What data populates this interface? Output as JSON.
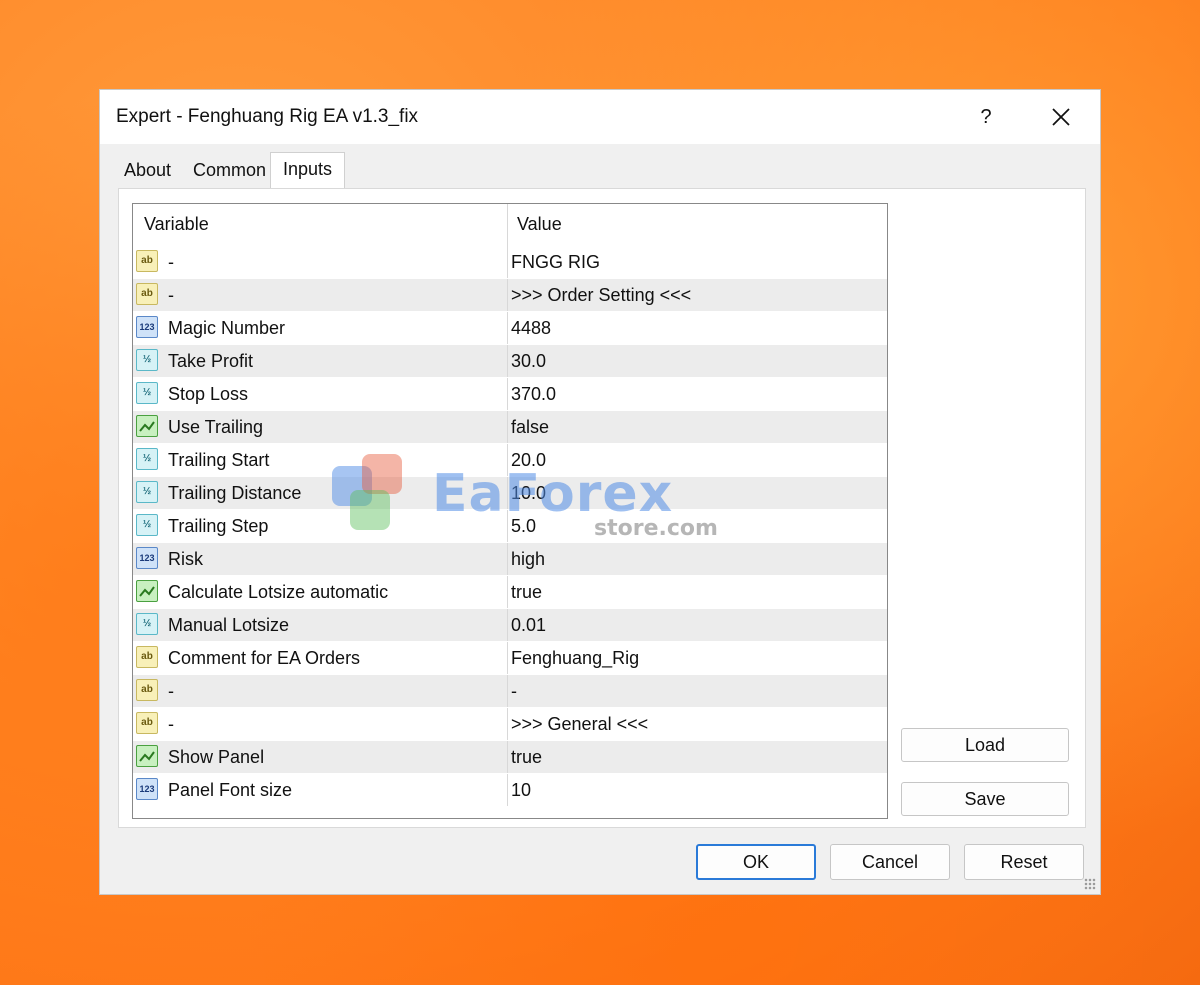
{
  "window": {
    "title": "Expert - Fenghuang Rig EA v1.3_fix",
    "help_label": "?"
  },
  "tabs": [
    {
      "label": "About"
    },
    {
      "label": "Common"
    },
    {
      "label": "Inputs"
    }
  ],
  "grid": {
    "header": {
      "variable": "Variable",
      "value": "Value"
    },
    "rows": [
      {
        "icon": "ab",
        "variable": "-",
        "value": "FNGG RIG"
      },
      {
        "icon": "ab",
        "variable": "-",
        "value": ">>> Order Setting <<<"
      },
      {
        "icon": "123",
        "variable": "Magic Number",
        "value": "4488"
      },
      {
        "icon": "½",
        "variable": "Take Profit",
        "value": "30.0"
      },
      {
        "icon": "½",
        "variable": "Stop Loss",
        "value": "370.0"
      },
      {
        "icon": "bool",
        "variable": "Use Trailing",
        "value": "false"
      },
      {
        "icon": "½",
        "variable": "Trailing Start",
        "value": "20.0"
      },
      {
        "icon": "½",
        "variable": "Trailing Distance",
        "value": "10.0"
      },
      {
        "icon": "½",
        "variable": "Trailing Step",
        "value": "5.0"
      },
      {
        "icon": "123",
        "variable": "Risk",
        "value": "high"
      },
      {
        "icon": "bool",
        "variable": "Calculate Lotsize automatic",
        "value": "true"
      },
      {
        "icon": "½",
        "variable": "Manual Lotsize",
        "value": "0.01"
      },
      {
        "icon": "ab",
        "variable": "Comment for EA Orders",
        "value": "Fenghuang_Rig"
      },
      {
        "icon": "ab",
        "variable": "-",
        "value": "-"
      },
      {
        "icon": "ab",
        "variable": "-",
        "value": ">>> General <<<"
      },
      {
        "icon": "bool",
        "variable": "Show Panel",
        "value": "true"
      },
      {
        "icon": "123",
        "variable": "Panel Font size",
        "value": "10"
      }
    ]
  },
  "side_buttons": {
    "load": "Load",
    "save": "Save"
  },
  "footer_buttons": {
    "ok": "OK",
    "cancel": "Cancel",
    "reset": "Reset"
  },
  "watermark": {
    "brand": "EaForex",
    "sub": "store.com"
  },
  "colors": {
    "accent": "#2a7ad8",
    "background": "#ff8a2a"
  }
}
